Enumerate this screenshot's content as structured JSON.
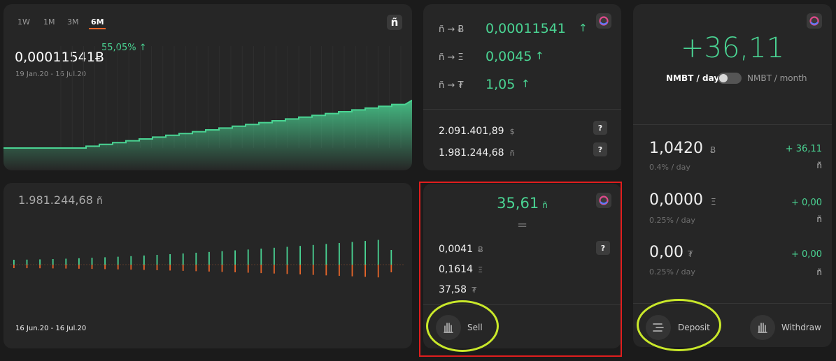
{
  "price_chart": {
    "timeframes": [
      "1W",
      "1M",
      "3M",
      "6M"
    ],
    "active_timeframe": "6M",
    "price": "0,00011541Ƀ",
    "change": "55,05%",
    "change_arrow": "↑",
    "range": "19 Jan.20 - 16 Jul.20",
    "logo": "ñ",
    "logo_icon": "nbt-logo-icon",
    "line_color": "#4ad493"
  },
  "rates": {
    "rows": [
      {
        "pair": "ñ → Ƀ",
        "value": "0,00011541",
        "arrow": "↑"
      },
      {
        "pair": "ñ → Ξ",
        "value": "0,0045",
        "arrow": "↑"
      },
      {
        "pair": "ñ → ₮",
        "value": "1,05",
        "arrow": "↑"
      }
    ],
    "totals": [
      {
        "value": "2.091.401,89",
        "unit": "$",
        "help": "?"
      },
      {
        "value": "1.981.244,68",
        "unit": "ñ",
        "help": "?"
      }
    ]
  },
  "earnings": {
    "value": "+36,11",
    "label_day": "NMBT / day",
    "label_month": "NMBT / month",
    "toggle_state": "day",
    "rows": [
      {
        "amount": "1,0420",
        "unit": "Ƀ",
        "rate": "0.4% / day",
        "gain": "+ 36,11",
        "gain_unit": "ñ"
      },
      {
        "amount": "0,0000",
        "unit": "Ξ",
        "rate": "0.25% / day",
        "gain": "+ 0,00",
        "gain_unit": "ñ"
      },
      {
        "amount": "0,00",
        "unit": "₮",
        "rate": "0.25% / day",
        "gain": "+ 0,00",
        "gain_unit": "ñ"
      }
    ],
    "deposit_label": "Deposit",
    "withdraw_label": "Withdraw"
  },
  "volume_chart": {
    "balance": "1.981.244,68",
    "balance_unit": "ñ",
    "range": "16 Jun.20 - 16 Jul.20",
    "up_color": "#4ad493",
    "down_color": "#e8662a"
  },
  "sell_card": {
    "value": "35,61",
    "unit": "ñ",
    "equals": "=",
    "rows": [
      {
        "value": "0,0041",
        "unit": "Ƀ"
      },
      {
        "value": "0,1614",
        "unit": "Ξ"
      },
      {
        "value": "37,58",
        "unit": "₮"
      }
    ],
    "help": "?",
    "sell_label": "Sell"
  },
  "annotations": {
    "highlight_color": "#e01e1e",
    "circle_color": "#c9e82a"
  }
}
